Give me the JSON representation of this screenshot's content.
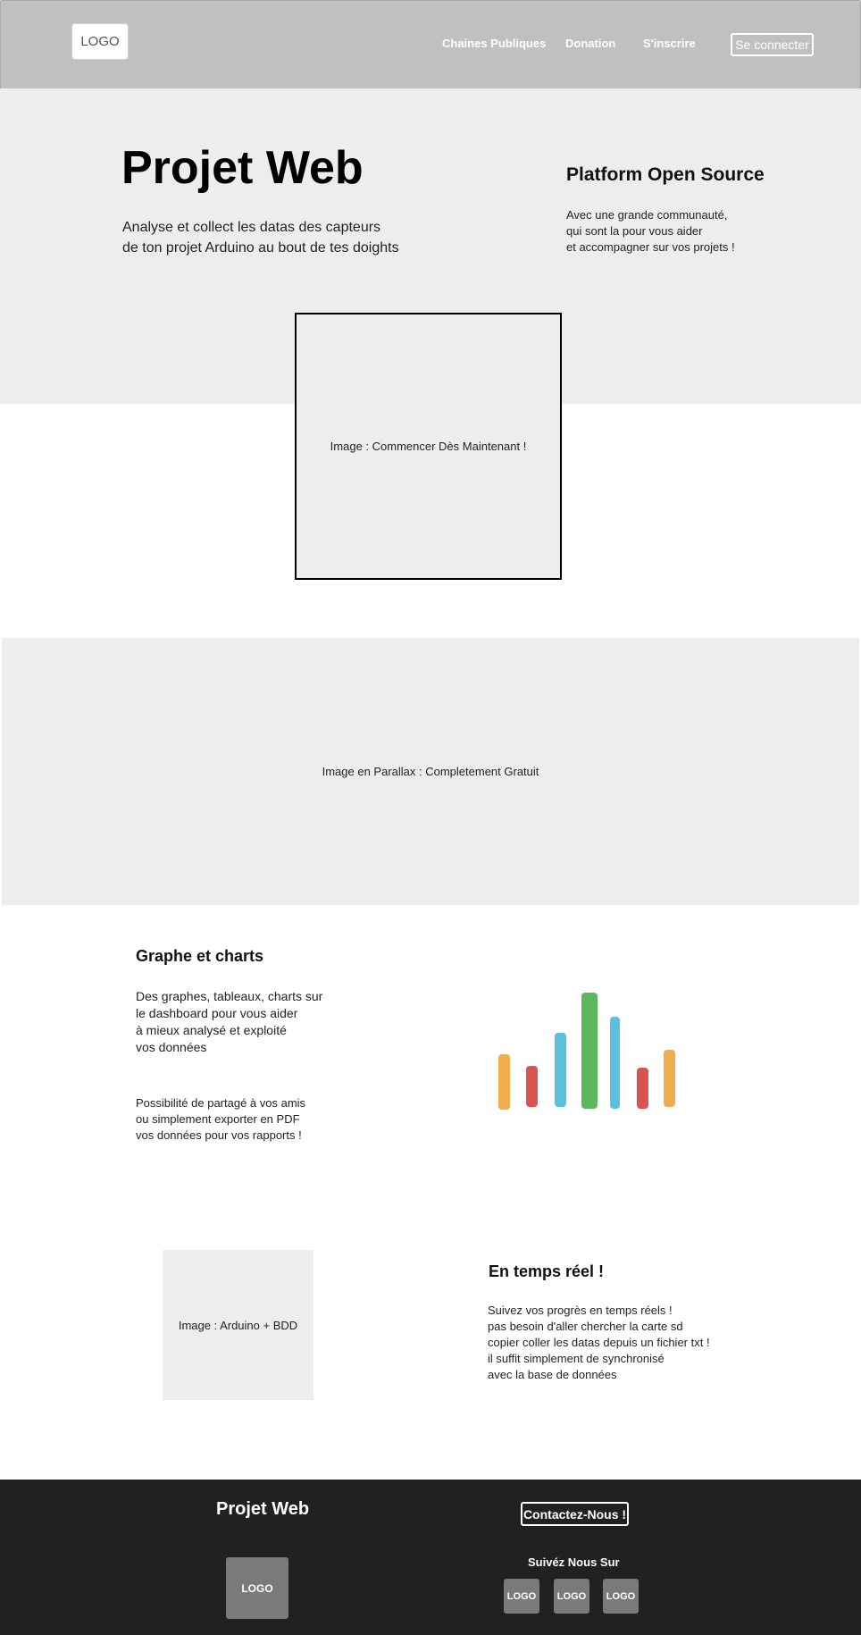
{
  "header": {
    "logo": "LOGO",
    "nav": [
      "Chaines Publiques",
      "Donation",
      "S'inscrire"
    ],
    "login_label": "Se connecter"
  },
  "hero": {
    "title": "Projet Web",
    "subtitle": "Analyse et collect les datas des capteurs\nde ton projet Arduino au bout de tes doights",
    "side_title": "Platform Open Source",
    "side_text": "Avec une grande communauté,\nqui sont la pour vous aider\net accompagner sur vos projets !",
    "start_image": "Image : Commencer Dès Maintenant !"
  },
  "parallax": {
    "label": "Image en Parallax : Completement Gratuit"
  },
  "charts_section": {
    "title": "Graphe et charts",
    "text1": "Des graphes, tableaux, charts sur\nle dashboard pour vous aider\nà mieux analysé et exploité\nvos données",
    "text2": "Possibilité de partagé à vos amis\nou simplement exporter en PDF\nvos données pour vos rapports !",
    "illustration_colors": [
      "#f0ad4e",
      "#d9534f",
      "#5bc0de",
      "#5cb85c",
      "#5bc0de",
      "#d9534f",
      "#f0ad4e"
    ]
  },
  "realtime_section": {
    "image_label": "Image : Arduino + BDD",
    "title": "En temps réel !",
    "text": "Suivez vos progrès en temps réels !\npas besoin d'aller chercher la carte sd\n copier coller les datas depuis un fichier txt !\n il suffit simplement de synchronisé\navec la base de données"
  },
  "footer": {
    "title": "Projet Web",
    "contact_label": "Contactez-Nous !",
    "follow_label": "Suivéz Nous Sur",
    "logo": "LOGO",
    "social": [
      "LOGO",
      "LOGO",
      "LOGO"
    ]
  }
}
